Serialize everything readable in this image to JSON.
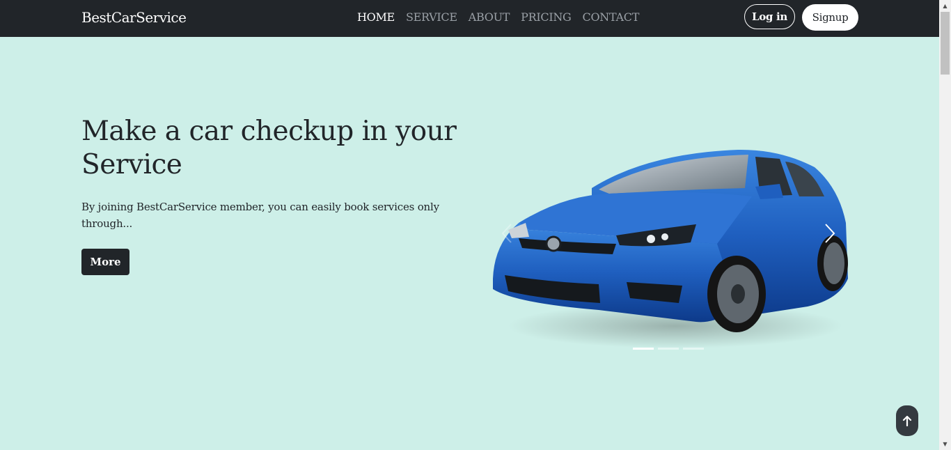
{
  "navbar": {
    "brand": "BestCarService",
    "links": [
      {
        "label": "HOME",
        "active": true
      },
      {
        "label": "SERVICE",
        "active": false
      },
      {
        "label": "ABOUT",
        "active": false
      },
      {
        "label": "PRICING",
        "active": false
      },
      {
        "label": "CONTACT",
        "active": false
      }
    ],
    "login_label": "Log in",
    "signup_label": "Signup"
  },
  "hero": {
    "title": "Make a car checkup in your Service",
    "text": "By joining BestCarService member, you can easily book services only through...",
    "more_label": "More"
  },
  "carousel": {
    "image": "blue-hatchback-car",
    "slide_count": 3,
    "active_slide": 1
  },
  "icons": {
    "prev": "chevron-left-icon",
    "next": "chevron-right-icon",
    "back_to_top": "arrow-up-icon"
  },
  "colors": {
    "navbar": "#212529",
    "background": "#cdefe8",
    "car_blue": "#1f5fbf"
  }
}
